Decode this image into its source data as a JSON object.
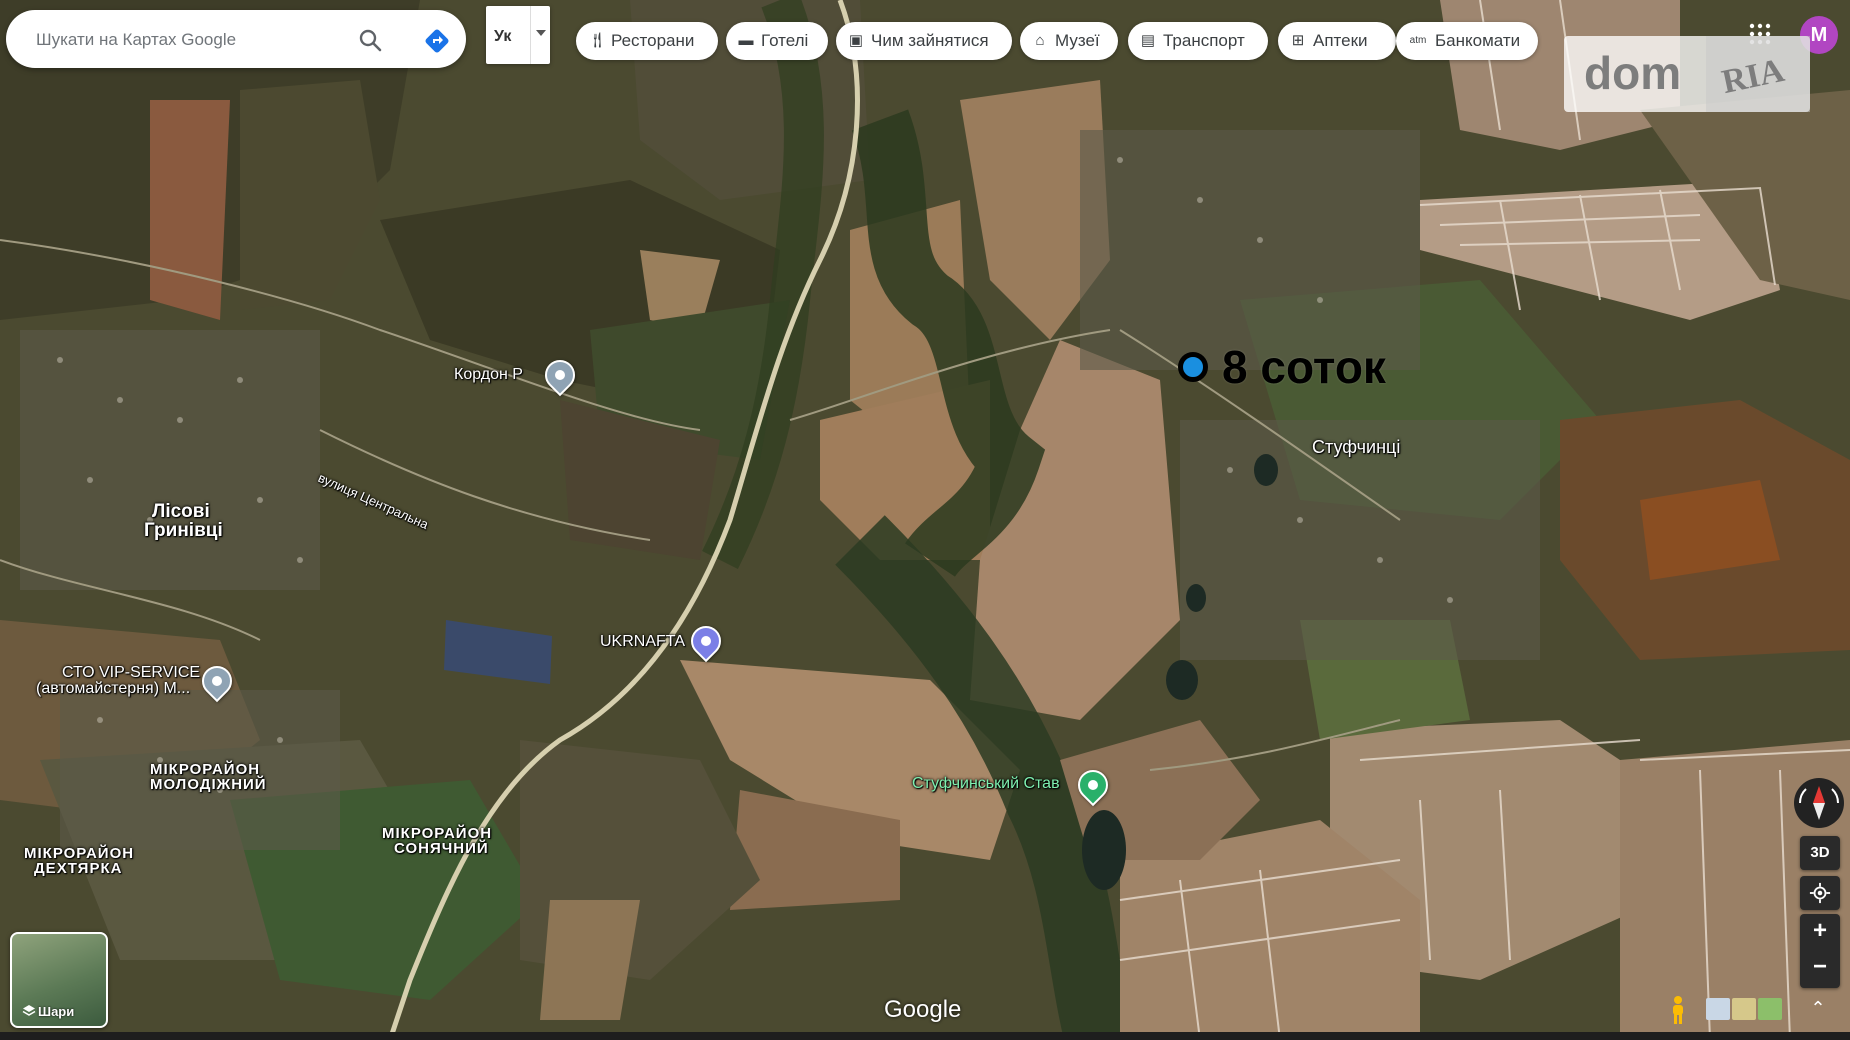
{
  "search": {
    "placeholder": "Шукати на Картах Google"
  },
  "language": {
    "label": "Ук"
  },
  "chips": [
    {
      "label": "Ресторани",
      "icon": "restaurant-icon"
    },
    {
      "label": "Готелі",
      "icon": "hotel-icon"
    },
    {
      "label": "Чим зайнятися",
      "icon": "camera-icon"
    },
    {
      "label": "Музеї",
      "icon": "museum-icon"
    },
    {
      "label": "Транспорт",
      "icon": "transit-icon"
    },
    {
      "label": "Аптеки",
      "icon": "pharmacy-icon"
    },
    {
      "label": "Банкомати",
      "icon": "atm-icon"
    }
  ],
  "account": {
    "initial": "M",
    "color": "#b146c2"
  },
  "watermark": {
    "left": "dom",
    "right": "RIA"
  },
  "annotation": {
    "text": "8 соток",
    "dot_color": "#1a8fe0"
  },
  "map_labels": {
    "kordon": "Кордон Р",
    "lisovi": "Лісові",
    "hrynivtsi": "Гринівці",
    "street": "вулиця Центральна",
    "ukrnafta": "UKRNAFTA",
    "sto1": "СТО VIP-SERVICE",
    "sto2": "(автомайстерня) М...",
    "molodizhnyi1": "МІКРОРАЙОН",
    "molodizhnyi2": "МОЛОДІЖНИЙ",
    "dekhtiarka1": "МІКРОРАЙОН",
    "dekhtiarka2": "ДЕХТЯРКА",
    "soniachnyi1": "МІКРОРАЙОН",
    "soniachnyi2": "СОНЯЧНИЙ",
    "stav": "Стуфчинський Став",
    "village": "Стуфчинці"
  },
  "controls": {
    "three_d": "3D",
    "zoom_in": "+",
    "zoom_out": "−",
    "layers": "Шари"
  },
  "branding": {
    "google": "Google"
  }
}
